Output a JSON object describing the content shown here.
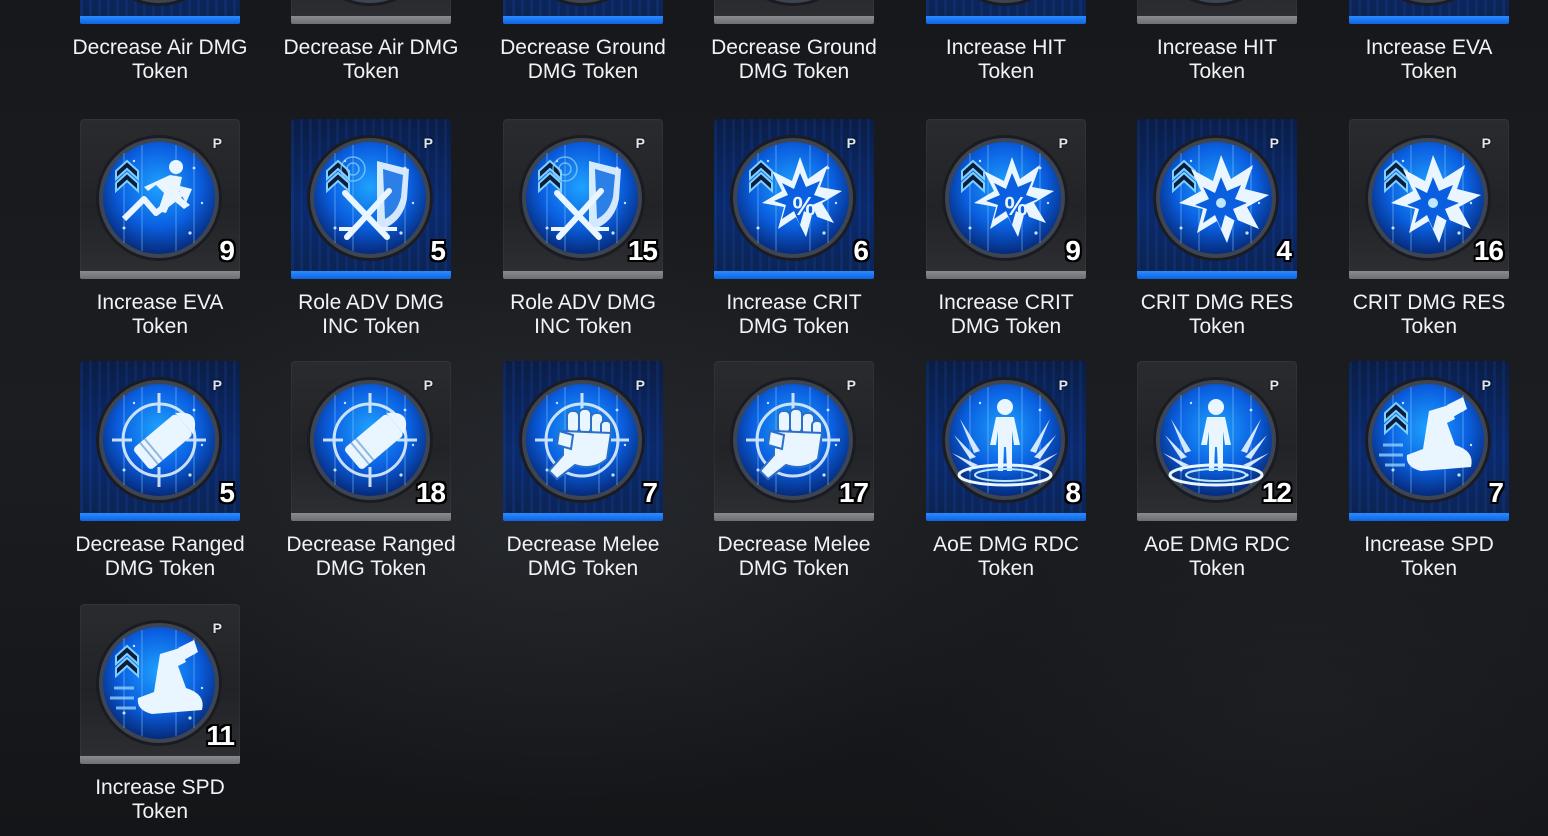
{
  "colors": {
    "accent": "#1a6cff",
    "tile_grey": "#26272a",
    "tile_blue": "#0b2a6c",
    "label_text": "#f2f3f5"
  },
  "rows": [
    {
      "items": [
        {
          "tile": "blue",
          "icon": "partial-icon",
          "count": "",
          "label": "Decrease Air DMG Token"
        },
        {
          "tile": "grey",
          "icon": "partial-icon",
          "count": "",
          "label": "Decrease Air DMG Token"
        },
        {
          "tile": "blue",
          "icon": "partial-icon",
          "count": "",
          "label": "Decrease Ground DMG Token"
        },
        {
          "tile": "grey",
          "icon": "partial-icon",
          "count": "",
          "label": "Decrease Ground DMG Token"
        },
        {
          "tile": "blue",
          "icon": "partial-icon",
          "count": "",
          "label": "Increase HIT Token"
        },
        {
          "tile": "grey",
          "icon": "partial-icon",
          "count": "",
          "label": "Increase HIT Token"
        },
        {
          "tile": "blue",
          "icon": "partial-icon",
          "count": "",
          "label": "Increase EVA Token"
        }
      ]
    },
    {
      "items": [
        {
          "tile": "grey",
          "icon": "evade-runner-icon",
          "count": "9",
          "p_badge": "P",
          "label": "Increase EVA Token"
        },
        {
          "tile": "blue",
          "icon": "crossed-swords-shield-icon",
          "count": "5",
          "p_badge": "P",
          "label": "Role ADV DMG INC Token"
        },
        {
          "tile": "grey",
          "icon": "crossed-swords-shield-icon",
          "count": "15",
          "p_badge": "P",
          "label": "Role ADV DMG INC Token"
        },
        {
          "tile": "blue",
          "icon": "crit-burst-percent-icon",
          "count": "6",
          "p_badge": "P",
          "label": "Increase CRIT DMG Token"
        },
        {
          "tile": "grey",
          "icon": "crit-burst-percent-icon",
          "count": "9",
          "p_badge": "P",
          "label": "Increase CRIT DMG Token"
        },
        {
          "tile": "blue",
          "icon": "burst-icon",
          "count": "4",
          "p_badge": "P",
          "label": "CRIT DMG RES Token"
        },
        {
          "tile": "grey",
          "icon": "burst-icon",
          "count": "16",
          "p_badge": "P",
          "label": "CRIT DMG RES Token"
        }
      ]
    },
    {
      "items": [
        {
          "tile": "blue",
          "icon": "bullet-crosshair-icon",
          "count": "5",
          "p_badge": "P",
          "label": "Decrease Ranged DMG Token"
        },
        {
          "tile": "grey",
          "icon": "bullet-crosshair-icon",
          "count": "18",
          "p_badge": "P",
          "label": "Decrease Ranged DMG Token"
        },
        {
          "tile": "blue",
          "icon": "fist-crosshair-icon",
          "count": "7",
          "p_badge": "P",
          "label": "Decrease Melee DMG Token"
        },
        {
          "tile": "grey",
          "icon": "fist-crosshair-icon",
          "count": "17",
          "p_badge": "P",
          "label": "Decrease Melee DMG Token"
        },
        {
          "tile": "blue",
          "icon": "person-shockwave-icon",
          "count": "8",
          "p_badge": "P",
          "label": "AoE DMG RDC Token"
        },
        {
          "tile": "grey",
          "icon": "person-shockwave-icon",
          "count": "12",
          "p_badge": "P",
          "label": "AoE DMG RDC Token"
        },
        {
          "tile": "blue",
          "icon": "winged-boot-icon",
          "count": "7",
          "p_badge": "P",
          "label": "Increase SPD Token"
        }
      ]
    },
    {
      "items": [
        {
          "tile": "grey",
          "icon": "winged-boot-icon",
          "count": "11",
          "p_badge": "P",
          "label": "Increase SPD Token"
        }
      ]
    }
  ]
}
